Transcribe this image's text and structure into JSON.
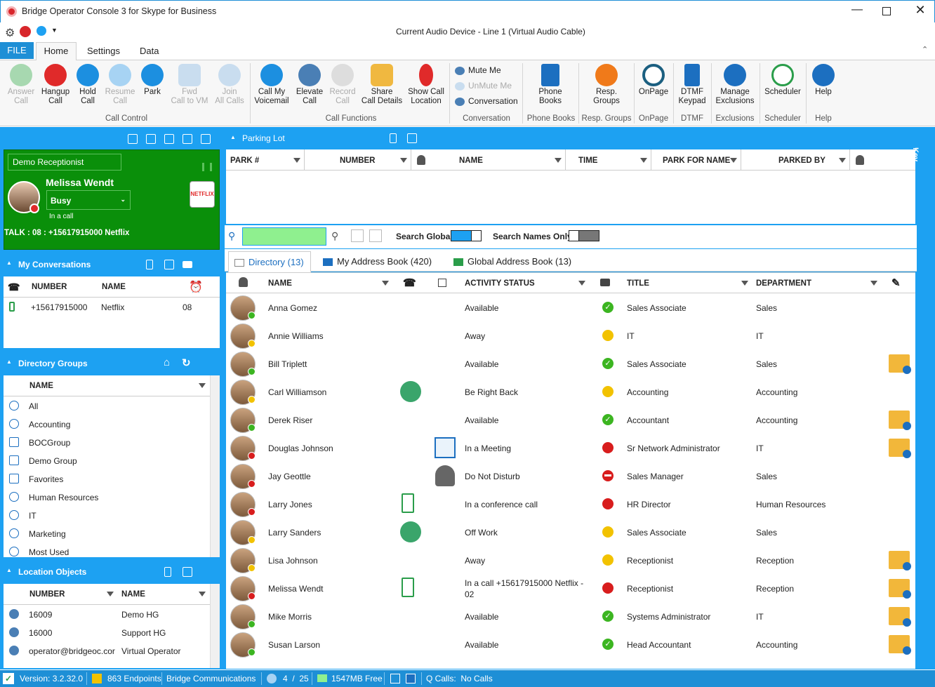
{
  "window": {
    "title": "Bridge Operator Console 3 for Skype for Business",
    "audio_device": "Current Audio Device - Line 1 (Virtual Audio Cable)"
  },
  "tabs": {
    "file": "FILE",
    "home": "Home",
    "settings": "Settings",
    "data": "Data"
  },
  "ribbon": {
    "answer": "Answer\nCall",
    "hangup": "Hangup\nCall",
    "hold": "Hold\nCall",
    "resume": "Resume\nCall",
    "park": "Park",
    "fwd": "Fwd\nCall to VM",
    "join": "Join\nAll Calls",
    "call_control": "Call Control",
    "voicemail": "Call My\nVoicemail",
    "elevate": "Elevate\nCall",
    "record": "Record\nCall",
    "share": "Share\nCall Details",
    "location": "Show Call\nLocation",
    "call_functions": "Call Functions",
    "mute": "Mute Me",
    "unmute": "UnMute Me",
    "conversation": "Conversation",
    "conversation_group": "Conversation",
    "phonebooks": "Phone\nBooks",
    "phonebooks_group": "Phone Books",
    "respgroups": "Resp.\nGroups",
    "respgroups_group": "Resp. Groups",
    "onpage": "OnPage",
    "onpage_group": "OnPage",
    "dtmf": "DTMF\nKeypad",
    "dtmf_group": "DTMF",
    "exclusions": "Manage\nExclusions",
    "exclusions_group": "Exclusions",
    "scheduler": "Scheduler",
    "scheduler_group": "Scheduler",
    "help": "Help",
    "help_group": "Help"
  },
  "profile": {
    "receptionist": "Demo Receptionist",
    "name": "Melissa Wendt",
    "status": "Busy",
    "substatus": "In a call",
    "talk": "TALK : 08 : +15617915000 Netflix",
    "badge": "NETFLIX"
  },
  "conversations": {
    "title": "My Conversations",
    "col_number": "NUMBER",
    "col_name": "NAME",
    "rows": [
      {
        "number": "+15617915000",
        "name": "Netflix",
        "time": "08"
      }
    ]
  },
  "dir_groups": {
    "title": "Directory Groups",
    "col_name": "NAME",
    "items": [
      "All",
      "Accounting",
      "BOCGroup",
      "Demo Group",
      "Favorites",
      "Human Resources",
      "IT",
      "Marketing",
      "Most Used"
    ]
  },
  "location": {
    "title": "Location Objects",
    "col_number": "NUMBER",
    "col_name": "NAME",
    "rows": [
      {
        "number": "16009",
        "name": "Demo HG"
      },
      {
        "number": "16000",
        "name": "Support HG"
      },
      {
        "number": "operator@bridgeoc.cor",
        "name": "Virtual Operator"
      }
    ]
  },
  "parking": {
    "title": "Parking Lot",
    "cols": [
      "PARK #",
      "NUMBER",
      "NAME",
      "TIME",
      "PARK FOR NAME",
      "PARKED BY"
    ]
  },
  "search": {
    "value": "",
    "global_label": "Search Global",
    "names_only_label": "Search Names Only",
    "key_label": "Key"
  },
  "dir_tabs": {
    "directory": "Directory (13)",
    "address": "My Address Book (420)",
    "global": "Global Address Book (13)"
  },
  "directory": {
    "cols": {
      "name": "NAME",
      "activity": "ACTIVITY STATUS",
      "title": "TITLE",
      "dept": "DEPARTMENT"
    },
    "rows": [
      {
        "name": "Anna Gomez",
        "activity": "Available",
        "title": "Sales Associate",
        "dept": "Sales",
        "status": "available",
        "note": false,
        "extra": ""
      },
      {
        "name": "Annie Williams",
        "activity": "Away",
        "title": "IT",
        "dept": "IT",
        "status": "away",
        "note": false,
        "extra": ""
      },
      {
        "name": "Bill Triplett",
        "activity": "Available",
        "title": "Sales Associate",
        "dept": "Sales",
        "status": "available",
        "note": true,
        "extra": ""
      },
      {
        "name": "Carl Williamson",
        "activity": "Be Right Back",
        "title": "Accounting",
        "dept": "Accounting",
        "status": "away",
        "note": false,
        "extra": "transfer"
      },
      {
        "name": "Derek Riser",
        "activity": "Available",
        "title": "Accountant",
        "dept": "Accounting",
        "status": "available",
        "note": true,
        "extra": ""
      },
      {
        "name": "Douglas Johnson",
        "activity": "In a Meeting",
        "title": "Sr Network Administrator",
        "dept": "IT",
        "status": "busy",
        "note": true,
        "extra": "calendar"
      },
      {
        "name": "Jay Geottle",
        "activity": "Do Not Disturb",
        "title": "Sales Manager",
        "dept": "Sales",
        "status": "dnd",
        "note": false,
        "extra": "dnd"
      },
      {
        "name": "Larry Jones",
        "activity": "In a conference call",
        "title": "HR Director",
        "dept": "Human Resources",
        "status": "busy",
        "note": false,
        "extra": "phone"
      },
      {
        "name": "Larry Sanders",
        "activity": "Off Work",
        "title": "Sales Associate",
        "dept": "Sales",
        "status": "away",
        "note": false,
        "extra": "transfer"
      },
      {
        "name": "Lisa Johnson",
        "activity": "Away",
        "title": "Receptionist",
        "dept": "Reception",
        "status": "away",
        "note": true,
        "extra": ""
      },
      {
        "name": "Melissa Wendt",
        "activity": "In a call +15617915000 Netflix -",
        "activity2": "02",
        "title": "Receptionist",
        "dept": "Reception",
        "status": "busy",
        "note": true,
        "extra": "phone"
      },
      {
        "name": "Mike Morris",
        "activity": "Available",
        "title": "Systems Administrator",
        "dept": "IT",
        "status": "available",
        "note": true,
        "extra": ""
      },
      {
        "name": "Susan Larson",
        "activity": "Available",
        "title": "Head Accountant",
        "dept": "Accounting",
        "status": "available",
        "note": true,
        "extra": ""
      }
    ]
  },
  "status": {
    "version": "Version: 3.2.32.0",
    "endpoints": "863 Endpoints",
    "company": "Bridge Communications",
    "pages": "4  /  25",
    "memory": "1547MB Free",
    "qcalls": "Q Calls:  No Calls"
  },
  "colors": {
    "accent": "#1da1f2",
    "green_panel": "#0a8f0a",
    "available": "#3cb521",
    "away": "#f2c200",
    "busy": "#d81d1d"
  }
}
